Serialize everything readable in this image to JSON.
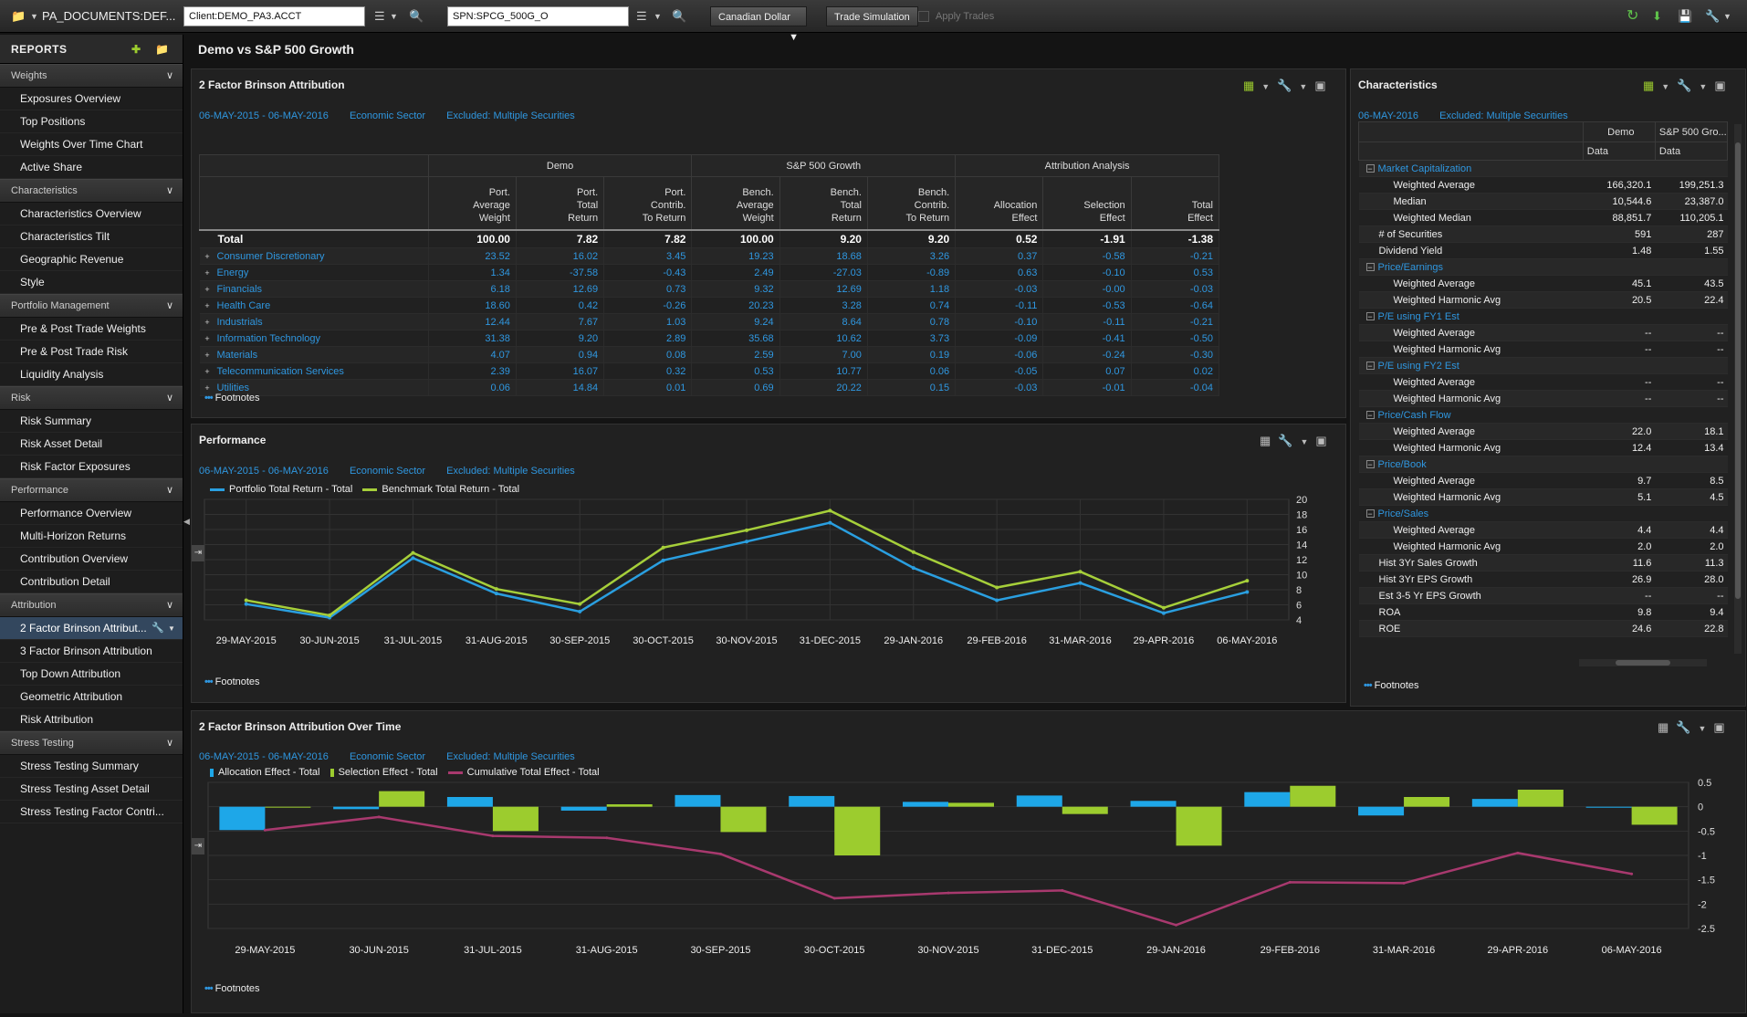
{
  "toolbar": {
    "doc_path": "PA_DOCUMENTS:DEF...",
    "client_value": "Client:DEMO_PA3.ACCT",
    "bench_value": "SPN:SPCG_500G_O",
    "currency": "Canadian Dollar",
    "trade_sim": "Trade Simulation",
    "apply_trades": "Apply Trades"
  },
  "sidebar": {
    "header": "REPORTS",
    "sections": [
      {
        "label": "Weights",
        "items": [
          "Exposures Overview",
          "Top Positions",
          "Weights Over Time Chart",
          "Active Share"
        ]
      },
      {
        "label": "Characteristics",
        "items": [
          "Characteristics Overview",
          "Characteristics Tilt",
          "Geographic Revenue",
          "Style"
        ]
      },
      {
        "label": "Portfolio Management",
        "items": [
          "Pre & Post Trade Weights",
          "Pre & Post Trade Risk",
          "Liquidity Analysis"
        ]
      },
      {
        "label": "Risk",
        "items": [
          "Risk Summary",
          "Risk Asset Detail",
          "Risk Factor Exposures"
        ]
      },
      {
        "label": "Performance",
        "items": [
          "Performance Overview",
          "Multi-Horizon Returns",
          "Contribution Overview",
          "Contribution Detail"
        ]
      },
      {
        "label": "Attribution",
        "items": [
          "2 Factor Brinson Attribut...",
          "3 Factor Brinson Attribution",
          "Top Down Attribution",
          "Geometric Attribution",
          "Risk Attribution"
        ]
      },
      {
        "label": "Stress Testing",
        "items": [
          "Stress Testing Summary",
          "Stress Testing Asset Detail",
          "Stress Testing Factor Contri..."
        ]
      }
    ]
  },
  "page_title": "Demo vs S&P 500 Growth",
  "brinson": {
    "title": "2 Factor Brinson Attribution",
    "date_range": "06-MAY-2015 - 06-MAY-2016",
    "grouping": "Economic Sector",
    "excluded": "Excluded: Multiple Securities",
    "groups": [
      "Demo",
      "S&P 500 Growth",
      "Attribution Analysis"
    ],
    "headers": [
      [
        "Port.",
        "Average",
        "Weight"
      ],
      [
        "Port.",
        "Total",
        "Return"
      ],
      [
        "Port.",
        "Contrib.",
        "To Return"
      ],
      [
        "Bench.",
        "Average",
        "Weight"
      ],
      [
        "Bench.",
        "Total",
        "Return"
      ],
      [
        "Bench.",
        "Contrib.",
        "To Return"
      ],
      [
        "",
        "Allocation",
        "Effect"
      ],
      [
        "",
        "Selection",
        "Effect"
      ],
      [
        "",
        "Total",
        "Effect"
      ]
    ],
    "total": {
      "label": "Total",
      "values": [
        "100.00",
        "7.82",
        "7.82",
        "100.00",
        "9.20",
        "9.20",
        "0.52",
        "-1.91",
        "-1.38"
      ]
    },
    "rows": [
      {
        "label": "Consumer Discretionary",
        "values": [
          "23.52",
          "16.02",
          "3.45",
          "19.23",
          "18.68",
          "3.26",
          "0.37",
          "-0.58",
          "-0.21"
        ]
      },
      {
        "label": "Energy",
        "values": [
          "1.34",
          "-37.58",
          "-0.43",
          "2.49",
          "-27.03",
          "-0.89",
          "0.63",
          "-0.10",
          "0.53"
        ]
      },
      {
        "label": "Financials",
        "values": [
          "6.18",
          "12.69",
          "0.73",
          "9.32",
          "12.69",
          "1.18",
          "-0.03",
          "-0.00",
          "-0.03"
        ]
      },
      {
        "label": "Health Care",
        "values": [
          "18.60",
          "0.42",
          "-0.26",
          "20.23",
          "3.28",
          "0.74",
          "-0.11",
          "-0.53",
          "-0.64"
        ]
      },
      {
        "label": "Industrials",
        "values": [
          "12.44",
          "7.67",
          "1.03",
          "9.24",
          "8.64",
          "0.78",
          "-0.10",
          "-0.11",
          "-0.21"
        ]
      },
      {
        "label": "Information Technology",
        "values": [
          "31.38",
          "9.20",
          "2.89",
          "35.68",
          "10.62",
          "3.73",
          "-0.09",
          "-0.41",
          "-0.50"
        ]
      },
      {
        "label": "Materials",
        "values": [
          "4.07",
          "0.94",
          "0.08",
          "2.59",
          "7.00",
          "0.19",
          "-0.06",
          "-0.24",
          "-0.30"
        ]
      },
      {
        "label": "Telecommunication Services",
        "values": [
          "2.39",
          "16.07",
          "0.32",
          "0.53",
          "10.77",
          "0.06",
          "-0.05",
          "0.07",
          "0.02"
        ]
      },
      {
        "label": "Utilities",
        "values": [
          "0.06",
          "14.84",
          "0.01",
          "0.69",
          "20.22",
          "0.15",
          "-0.03",
          "-0.01",
          "-0.04"
        ]
      }
    ],
    "footnotes": "Footnotes"
  },
  "characteristics": {
    "title": "Characteristics",
    "date": "06-MAY-2016",
    "excluded": "Excluded: Multiple Securities",
    "col1": "Demo",
    "col2": "S&P 500 Gro...",
    "sub1": "Data",
    "sub2": "Data",
    "rows": [
      {
        "type": "grp",
        "label": "Market Capitalization",
        "v1": "",
        "v2": ""
      },
      {
        "type": "sub",
        "label": "Weighted Average",
        "v1": "166,320.1",
        "v2": "199,251.3"
      },
      {
        "type": "sub",
        "label": "Median",
        "v1": "10,544.6",
        "v2": "23,387.0"
      },
      {
        "type": "sub",
        "label": "Weighted Median",
        "v1": "88,851.7",
        "v2": "110,205.1"
      },
      {
        "type": "top",
        "label": "# of Securities",
        "v1": "591",
        "v2": "287"
      },
      {
        "type": "top",
        "label": "Dividend Yield",
        "v1": "1.48",
        "v2": "1.55"
      },
      {
        "type": "grp",
        "label": "Price/Earnings",
        "v1": "",
        "v2": ""
      },
      {
        "type": "sub",
        "label": "Weighted Average",
        "v1": "45.1",
        "v2": "43.5"
      },
      {
        "type": "sub",
        "label": "Weighted Harmonic Avg",
        "v1": "20.5",
        "v2": "22.4"
      },
      {
        "type": "grp",
        "label": "P/E using FY1 Est",
        "v1": "",
        "v2": ""
      },
      {
        "type": "sub",
        "label": "Weighted Average",
        "v1": "--",
        "v2": "--"
      },
      {
        "type": "sub",
        "label": "Weighted Harmonic Avg",
        "v1": "--",
        "v2": "--"
      },
      {
        "type": "grp",
        "label": "P/E using FY2 Est",
        "v1": "",
        "v2": ""
      },
      {
        "type": "sub",
        "label": "Weighted Average",
        "v1": "--",
        "v2": "--"
      },
      {
        "type": "sub",
        "label": "Weighted Harmonic Avg",
        "v1": "--",
        "v2": "--"
      },
      {
        "type": "grp",
        "label": "Price/Cash Flow",
        "v1": "",
        "v2": ""
      },
      {
        "type": "sub",
        "label": "Weighted Average",
        "v1": "22.0",
        "v2": "18.1"
      },
      {
        "type": "sub",
        "label": "Weighted Harmonic Avg",
        "v1": "12.4",
        "v2": "13.4"
      },
      {
        "type": "grp",
        "label": "Price/Book",
        "v1": "",
        "v2": ""
      },
      {
        "type": "sub",
        "label": "Weighted Average",
        "v1": "9.7",
        "v2": "8.5"
      },
      {
        "type": "sub",
        "label": "Weighted Harmonic Avg",
        "v1": "5.1",
        "v2": "4.5"
      },
      {
        "type": "grp",
        "label": "Price/Sales",
        "v1": "",
        "v2": ""
      },
      {
        "type": "sub",
        "label": "Weighted Average",
        "v1": "4.4",
        "v2": "4.4"
      },
      {
        "type": "sub",
        "label": "Weighted Harmonic Avg",
        "v1": "2.0",
        "v2": "2.0"
      },
      {
        "type": "top",
        "label": "Hist 3Yr Sales Growth",
        "v1": "11.6",
        "v2": "11.3"
      },
      {
        "type": "top",
        "label": "Hist 3Yr EPS Growth",
        "v1": "26.9",
        "v2": "28.0"
      },
      {
        "type": "top",
        "label": "Est 3-5 Yr EPS Growth",
        "v1": "--",
        "v2": "--"
      },
      {
        "type": "top",
        "label": "ROA",
        "v1": "9.8",
        "v2": "9.4"
      },
      {
        "type": "top",
        "label": "ROE",
        "v1": "24.6",
        "v2": "22.8"
      }
    ],
    "footnotes": "Footnotes"
  },
  "performance": {
    "title": "Performance",
    "date_range": "06-MAY-2015 - 06-MAY-2016",
    "grouping": "Economic Sector",
    "excluded": "Excluded: Multiple Securities",
    "footnotes": "Footnotes",
    "colors": {
      "portfolio": "#2a9fe0",
      "benchmark": "#a6cf3a"
    },
    "chart_data": {
      "type": "line",
      "categories": [
        "29-MAY-2015",
        "30-JUN-2015",
        "31-JUL-2015",
        "31-AUG-2015",
        "30-SEP-2015",
        "30-OCT-2015",
        "30-NOV-2015",
        "31-DEC-2015",
        "29-JAN-2016",
        "29-FEB-2016",
        "31-MAR-2016",
        "29-APR-2016",
        "06-MAY-2016"
      ],
      "series": [
        {
          "name": "Portfolio Total Return - Total",
          "values": [
            6.1,
            4.3,
            12.2,
            7.5,
            5.1,
            11.9,
            14.4,
            16.9,
            10.9,
            6.6,
            8.9,
            4.9,
            7.7
          ]
        },
        {
          "name": "Benchmark Total Return - Total",
          "values": [
            6.6,
            4.6,
            12.9,
            8.1,
            6.1,
            13.6,
            15.9,
            18.5,
            13.0,
            8.3,
            10.4,
            5.6,
            9.2
          ]
        }
      ],
      "ylim": [
        4,
        20
      ],
      "yticks": [
        4,
        6,
        8,
        10,
        12,
        14,
        16,
        18,
        20
      ],
      "grid": true,
      "legend": "top-left"
    }
  },
  "attrib_time": {
    "title": "2 Factor Brinson Attribution Over Time",
    "date_range": "06-MAY-2015 - 06-MAY-2016",
    "grouping": "Economic Sector",
    "excluded": "Excluded: Multiple Securities",
    "footnotes": "Footnotes",
    "colors": {
      "allocation": "#1ea7e8",
      "selection": "#9ccc2e",
      "cumulative": "#a8396e"
    },
    "chart_data": {
      "type": "bar",
      "categories": [
        "29-MAY-2015",
        "30-JUN-2015",
        "31-JUL-2015",
        "31-AUG-2015",
        "30-SEP-2015",
        "30-OCT-2015",
        "30-NOV-2015",
        "31-DEC-2015",
        "29-JAN-2016",
        "29-FEB-2016",
        "31-MAR-2016",
        "29-APR-2016",
        "06-MAY-2016"
      ],
      "series": [
        {
          "name": "Allocation Effect - Total",
          "type": "bar",
          "values": [
            -0.48,
            -0.05,
            0.2,
            -0.08,
            0.24,
            0.22,
            0.1,
            0.23,
            0.12,
            0.3,
            -0.18,
            0.16,
            -0.02
          ]
        },
        {
          "name": "Selection Effect - Total",
          "type": "bar",
          "values": [
            0.0,
            0.32,
            -0.5,
            0.05,
            -0.52,
            -1.0,
            0.08,
            -0.15,
            -0.8,
            0.43,
            0.2,
            0.35,
            -0.37
          ]
        },
        {
          "name": "Cumulative Total Effect - Total",
          "type": "line",
          "values": [
            -0.48,
            -0.21,
            -0.6,
            -0.64,
            -0.97,
            -1.88,
            -1.77,
            -1.72,
            -2.43,
            -1.55,
            -1.57,
            -0.95,
            -1.38
          ]
        }
      ],
      "ylim": [
        -2.5,
        0.5
      ],
      "yticks": [
        0.5,
        0,
        -0.5,
        -1,
        -1.5,
        -2,
        -2.5
      ],
      "grid": true,
      "legend": "top-left"
    }
  }
}
